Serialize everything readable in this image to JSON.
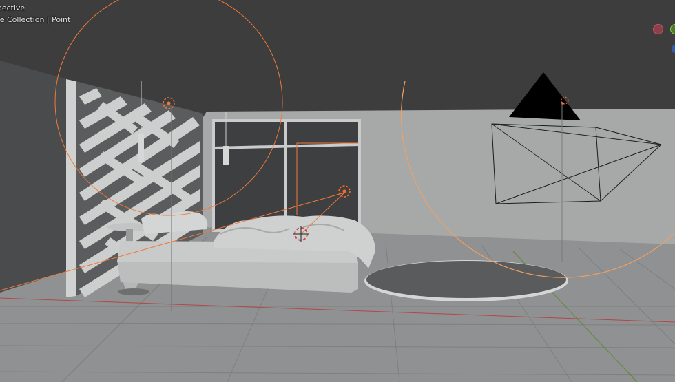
{
  "viewport": {
    "view_name": "User Perspective",
    "view_name_visible": "spective",
    "collection_line": "ene Collection | Point"
  },
  "navigation_gizmo": {
    "x_axis_color": "#c95562",
    "y_axis_color": "#8bd34a",
    "z_axis_color": "#2f5ea6"
  },
  "colors": {
    "background_ceiling": "#3d3d3d",
    "wall": "#a7a9a9",
    "floor": "#8f9192",
    "light_selected": "#ff6a2a",
    "light_unselected": "#f28a3a",
    "x_axis_line": "#b54646",
    "y_axis_line": "#5c8a32"
  }
}
